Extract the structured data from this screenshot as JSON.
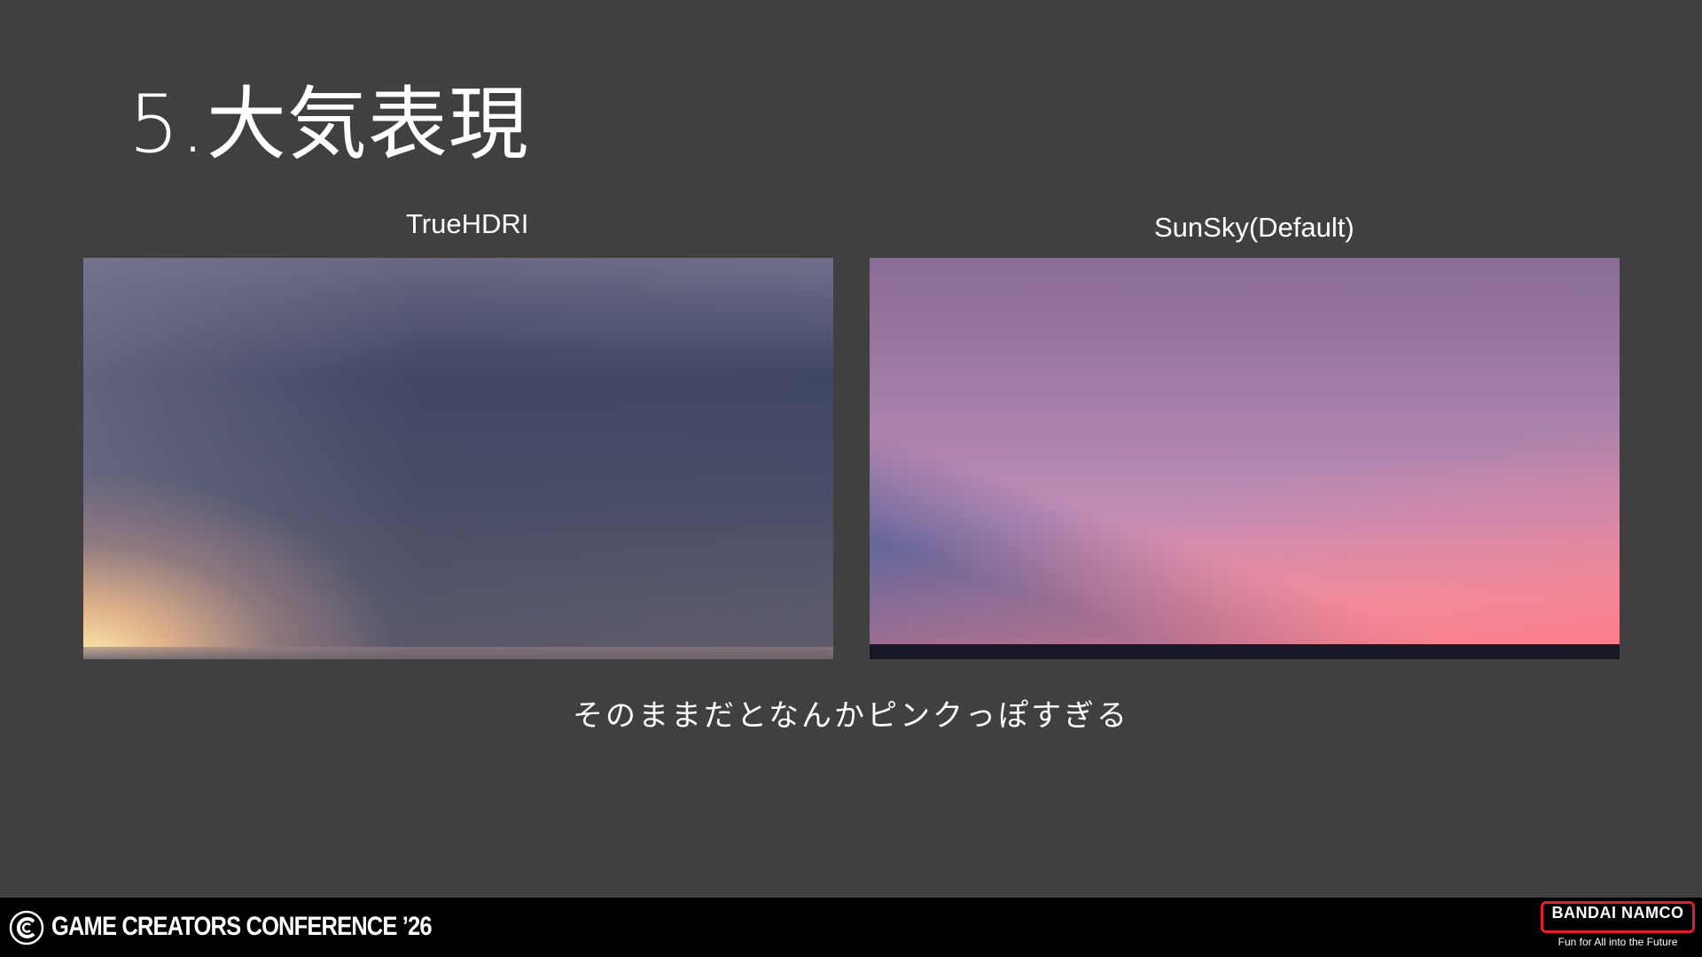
{
  "slide": {
    "title": "5.大気表現",
    "panels": [
      {
        "label": "TrueHDRI"
      },
      {
        "label": "SunSky(Default)"
      }
    ],
    "caption": "そのままだとなんかピンクっぽすぎる"
  },
  "footer": {
    "conference": "GAME CREATORS CONFERENCE ’26",
    "brand": "BANDAI NAMCO",
    "brand_tagline": "Fun for All into the Future",
    "brand_color": "#e0202a"
  }
}
